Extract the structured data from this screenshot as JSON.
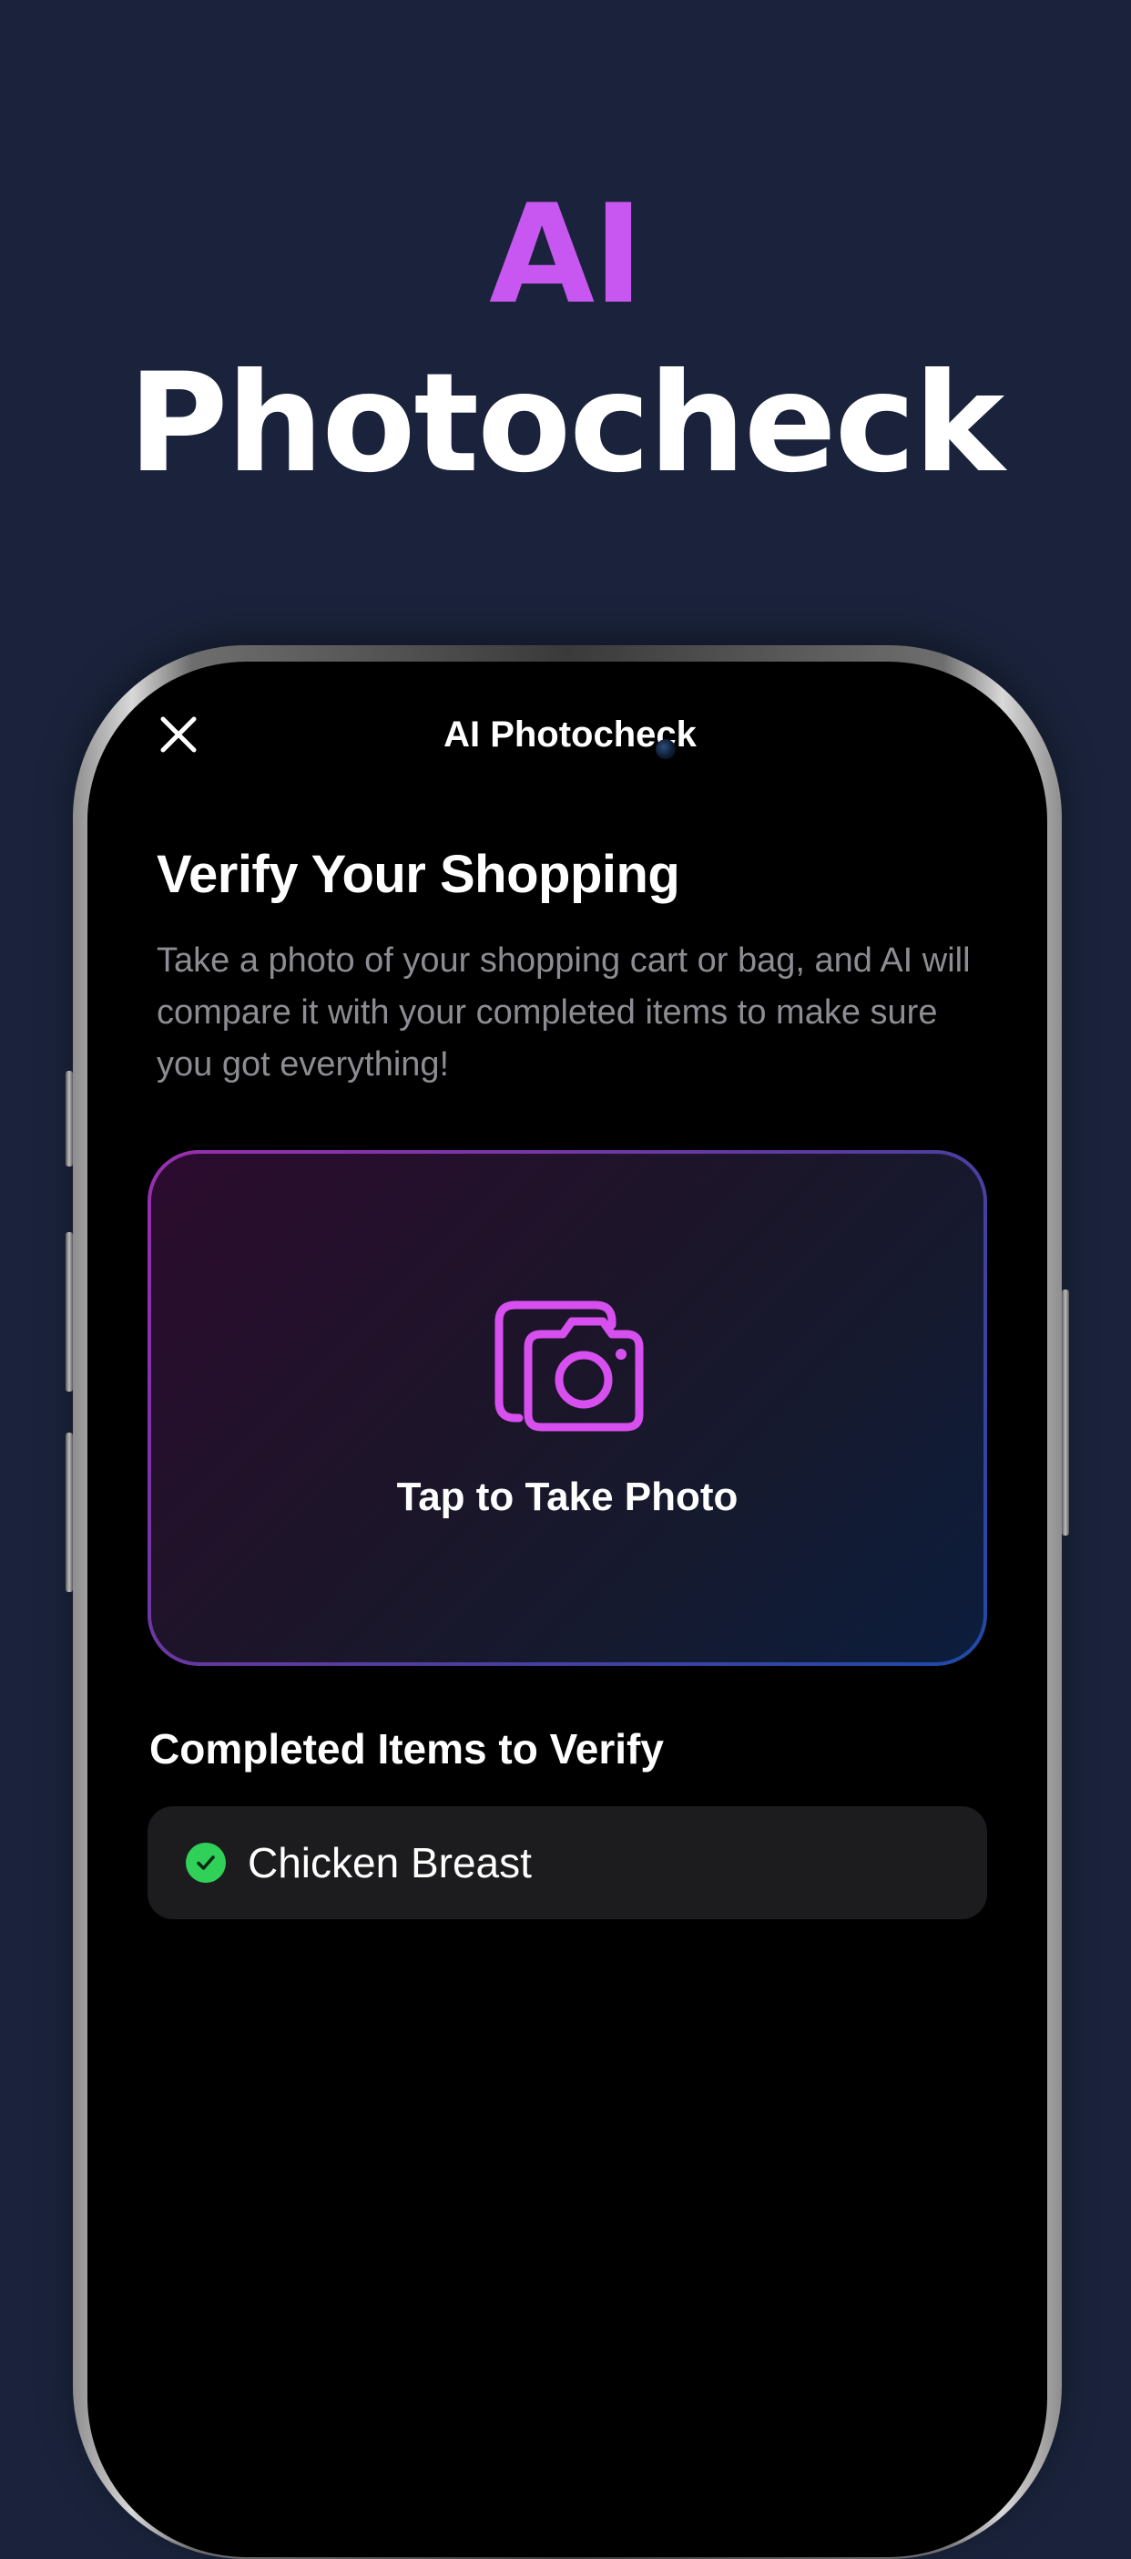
{
  "hero": {
    "line1": "AI",
    "line2": "Photocheck"
  },
  "screen": {
    "nav_title": "AI Photocheck",
    "close_icon": "close-icon",
    "title": "Verify Your Shopping",
    "description": "Take a photo of your shopping cart or bag, and AI will compare it with your completed items to make sure you got everything!"
  },
  "photo_card": {
    "icon": "camera-icon",
    "label": "Tap to Take Photo"
  },
  "completed": {
    "title": "Completed Items to Verify",
    "items": [
      {
        "label": "Chicken Breast",
        "icon": "checkmark-circle-icon"
      }
    ]
  },
  "colors": {
    "background": "#1a233b",
    "accent_purple": "#c757f0",
    "check_green": "#30d158",
    "card_border_start": "#9a2fb0",
    "card_border_end": "#1e4aa8"
  }
}
